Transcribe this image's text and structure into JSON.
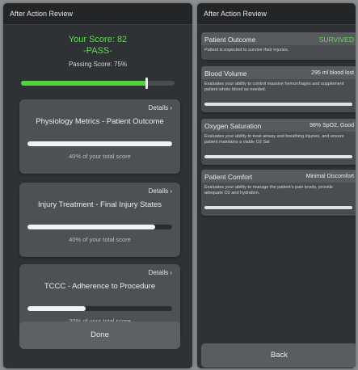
{
  "left_panel": {
    "title": "After Action Review",
    "score_line": "Your Score: 82",
    "score_result": "-PASS-",
    "passing_score": "Passing Score: 75%",
    "score_value": 82,
    "passing_value": 75,
    "cards": [
      {
        "details_label": "Details ›",
        "title": "Physiology Metrics - Patient Outcome",
        "percent_label": "40% of your total score",
        "progress": 1.0
      },
      {
        "details_label": "Details ›",
        "title": "Injury Treatment - Final Injury States",
        "percent_label": "40% of your total score",
        "progress": 0.88
      },
      {
        "details_label": "Details ›",
        "title": "TCCC - Adherence to Procedure",
        "percent_label": "20% of your total score",
        "progress": 0.4
      }
    ],
    "done_label": "Done"
  },
  "right_panel": {
    "title": "After Action Review",
    "items": [
      {
        "label": "Patient Outcome",
        "value": "SURVIVED",
        "description": "Patient is expected to survive their injuries.",
        "value_color": "#5be04a"
      },
      {
        "label": "Blood Volume",
        "value": "295 ml blood lost",
        "description": "Evaluates your ability to control massive hemorrhages and supplement patient whole blood as needed.",
        "value_color": "#ececec"
      },
      {
        "label": "Oxygen Saturation",
        "value": "98% SpO2, Good",
        "description": "Evaluates your ability to treat airway and breathing injuries, and ensure patient maintains a viable O2 Sat",
        "value_color": "#ececec"
      },
      {
        "label": "Patient Comfort",
        "value": "Minimal Discomfort",
        "description": "Evaluates your ability to manage the patient's pain levels, provide adequate O2 and hydration.",
        "value_color": "#ececec"
      }
    ],
    "back_label": "Back"
  },
  "colors": {
    "accent_green": "#4fd63b",
    "panel_bg": "#2f3234",
    "card_bg": "#4e5153"
  }
}
